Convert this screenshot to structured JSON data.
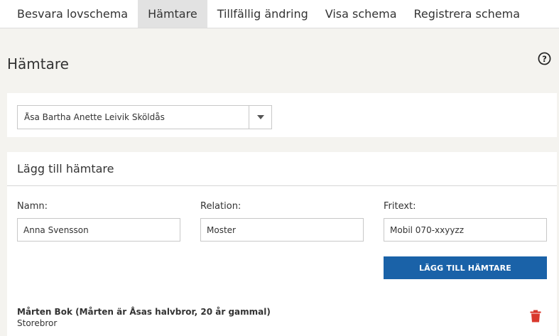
{
  "tabs": [
    {
      "label": "Besvara lovschema"
    },
    {
      "label": "Hämtare"
    },
    {
      "label": "Tillfällig ändring"
    },
    {
      "label": "Visa schema"
    },
    {
      "label": "Registrera schema"
    }
  ],
  "page": {
    "title": "Hämtare"
  },
  "child_select": {
    "selected": "Åsa Bartha Anette Leivik Sköldås"
  },
  "add_form": {
    "header": "Lägg till hämtare",
    "name_label": "Namn:",
    "name_value": "Anna Svensson",
    "relation_label": "Relation:",
    "relation_value": "Moster",
    "freetext_label": "Fritext:",
    "freetext_value": "Mobil 070-xxyyzz",
    "submit_label": "LÄGG TILL HÄMTARE"
  },
  "pickups": [
    {
      "name": "Mårten Bok (Mårten är Åsas halvbror, 20 år gammal)",
      "relation": "Storebror"
    }
  ],
  "colors": {
    "primary": "#1a62a8",
    "delete": "#d9382c",
    "background": "#f4f3ef"
  }
}
